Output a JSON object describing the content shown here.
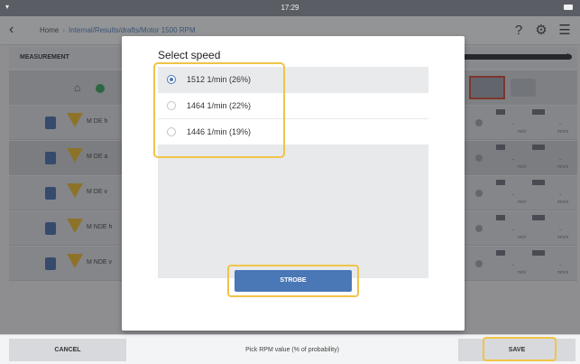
{
  "status_bar": {
    "time": "17:29"
  },
  "nav": {
    "home": "Home",
    "path": "Internal/Results/drafts/Motor 1500 RPM",
    "icons": [
      "back-icon",
      "help-icon",
      "settings-icon",
      "menu-icon"
    ]
  },
  "measurement": {
    "header": "MEASUREMENT",
    "count": "1",
    "rows": [
      {
        "name": "M DE h"
      },
      {
        "name": "M DE a"
      },
      {
        "name": "M DE v"
      },
      {
        "name": "M NDE h"
      },
      {
        "name": "M NDE v"
      }
    ],
    "value_placeholder": "-",
    "unit1": "m/s²",
    "unit2": "mm/s"
  },
  "dialog": {
    "title": "Select speed",
    "options": [
      {
        "label": "1512 1/min (26%)",
        "selected": true
      },
      {
        "label": "1464 1/min (22%)",
        "selected": false
      },
      {
        "label": "1446 1/min (19%)",
        "selected": false
      }
    ],
    "strobe_label": "STROBE"
  },
  "bottom": {
    "cancel": "CANCEL",
    "hint": "Pick RPM value (% of probability)",
    "save": "SAVE"
  },
  "colors": {
    "accent": "#4a78b6",
    "highlight": "#f0c449",
    "ok": "#3aa35a",
    "warning": "#e8b930"
  }
}
